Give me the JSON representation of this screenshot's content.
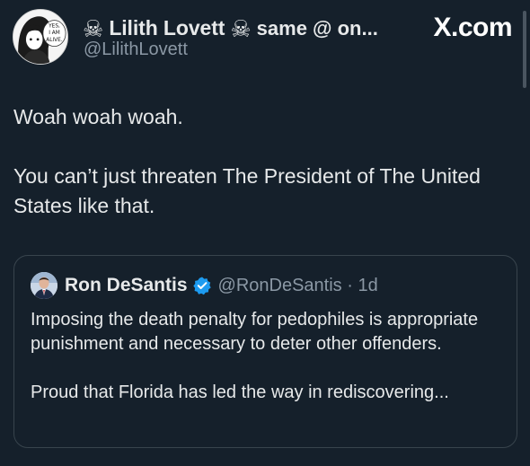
{
  "post": {
    "author": {
      "display_name": "Lilith Lovett",
      "name_suffix": "same @ on...",
      "handle": "@LilithLovett",
      "emoji_icon": "skull-crossbones-icon",
      "avatar_text": [
        "YES,",
        "I AM",
        "ALIVE."
      ]
    },
    "site_logo": "X.com",
    "body": [
      "Woah woah woah.",
      "You can’t just threaten The President of The United States like that."
    ]
  },
  "quoted_post": {
    "display_name": "Ron DeSantis",
    "handle_time": "@RonDeSantis · 1d",
    "verified_icon": "verified-badge-icon",
    "text": [
      "Imposing the death penalty for pedophiles is appropriate punishment and necessary to deter other offenders.",
      "Proud that Florida has led the way in rediscovering..."
    ]
  },
  "colors": {
    "background": "#15202b",
    "text": "#e7e9ea",
    "secondary": "#8b98a5",
    "border": "#38444d",
    "verified": "#1d9bf0"
  }
}
